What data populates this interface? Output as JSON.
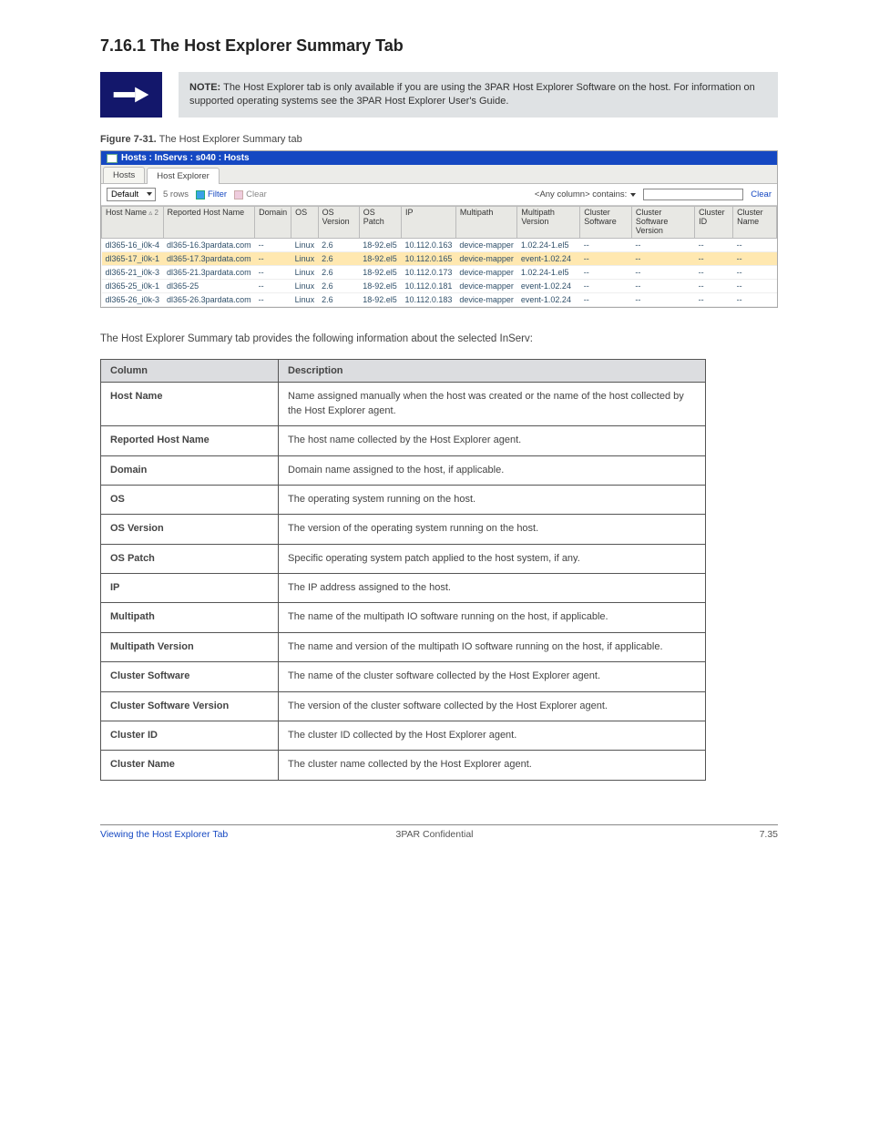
{
  "section": {
    "number": "7.16.1",
    "title": "The Host Explorer Summary Tab"
  },
  "note": {
    "label": "NOTE:",
    "body": "The Host Explorer tab is only available if you are using the 3PAR Host Explorer Software on the host. For information on supported operating systems see the 3PAR Host Explorer User's Guide."
  },
  "figure": {
    "label": "Figure 7-31.",
    "caption": "The Host Explorer Summary tab"
  },
  "screenshot": {
    "title": "Hosts : InServs : s040 : Hosts",
    "tabs": [
      "Hosts",
      "Host Explorer"
    ],
    "toolbar": {
      "view": "Default",
      "rowcount": "5 rows",
      "filter_label": "Filter",
      "clear_label": "Clear",
      "search_dd": "<Any column> contains:",
      "clear_btn": "Clear"
    },
    "columns": [
      "Host Name",
      "Reported Host Name",
      "Domain",
      "OS",
      "OS Version",
      "OS Patch",
      "IP",
      "Multipath",
      "Multipath Version",
      "Cluster Software",
      "Cluster Software Version",
      "Cluster ID",
      "Cluster Name"
    ],
    "sort_indicator": "▵ 2",
    "rows": [
      {
        "host": "dl365-16_i0k-4",
        "reported": "dl365-16.3pardata.com",
        "domain": "--",
        "os": "Linux",
        "osv": "2.6",
        "patch": "18-92.el5",
        "ip": "10.112.0.163",
        "mp": "device-mapper",
        "mpv": "1.02.24-1.el5",
        "csw": "--",
        "csv": "--",
        "cid": "--",
        "cname": "--"
      },
      {
        "host": "dl365-17_i0k-1",
        "reported": "dl365-17.3pardata.com",
        "domain": "--",
        "os": "Linux",
        "osv": "2.6",
        "patch": "18-92.el5",
        "ip": "10.112.0.165",
        "mp": "device-mapper",
        "mpv": "event-1.02.24",
        "csw": "--",
        "csv": "--",
        "cid": "--",
        "cname": "--",
        "sel": true
      },
      {
        "host": "dl365-21_i0k-3",
        "reported": "dl365-21.3pardata.com",
        "domain": "--",
        "os": "Linux",
        "osv": "2.6",
        "patch": "18-92.el5",
        "ip": "10.112.0.173",
        "mp": "device-mapper",
        "mpv": "1.02.24-1.el5",
        "csw": "--",
        "csv": "--",
        "cid": "--",
        "cname": "--"
      },
      {
        "host": "dl365-25_i0k-1",
        "reported": "dl365-25",
        "domain": "--",
        "os": "Linux",
        "osv": "2.6",
        "patch": "18-92.el5",
        "ip": "10.112.0.181",
        "mp": "device-mapper",
        "mpv": "event-1.02.24",
        "csw": "--",
        "csv": "--",
        "cid": "--",
        "cname": "--"
      },
      {
        "host": "dl365-26_i0k-3",
        "reported": "dl365-26.3pardata.com",
        "domain": "--",
        "os": "Linux",
        "osv": "2.6",
        "patch": "18-92.el5",
        "ip": "10.112.0.183",
        "mp": "device-mapper",
        "mpv": "event-1.02.24",
        "csw": "--",
        "csv": "--",
        "cid": "--",
        "cname": "--"
      }
    ]
  },
  "description": "The Host Explorer Summary tab provides the following information about the selected InServ:",
  "summary": {
    "headers": [
      "Column",
      "Description"
    ],
    "rows": [
      [
        "Host Name",
        "Name assigned manually when the host was created or the name of the host collected by the Host Explorer agent."
      ],
      [
        "Reported Host Name",
        "The host name collected by the Host Explorer agent."
      ],
      [
        "Domain",
        "Domain name assigned to the host, if applicable."
      ],
      [
        "OS",
        "The operating system running on the host."
      ],
      [
        "OS Version",
        "The version of the operating system running on the host."
      ],
      [
        "OS Patch",
        "Specific operating system patch applied to the host system, if any."
      ],
      [
        "IP",
        "The IP address assigned to the host."
      ],
      [
        "Multipath",
        "The name of the multipath IO software running on the host, if applicable."
      ],
      [
        "Multipath Version",
        "The name and version of the multipath IO software running on the host, if applicable."
      ],
      [
        "Cluster Software",
        "The name of the cluster software collected by the Host Explorer agent."
      ],
      [
        "Cluster Software Version",
        "The version of the cluster software collected by the Host Explorer agent."
      ],
      [
        "Cluster ID",
        "The cluster ID collected by the Host Explorer agent."
      ],
      [
        "Cluster Name",
        "The cluster name collected by the Host Explorer agent."
      ]
    ]
  },
  "footer": {
    "left": "Viewing the Host Explorer Tab",
    "center_label": "3PAR Confidential",
    "right": "7.35"
  }
}
